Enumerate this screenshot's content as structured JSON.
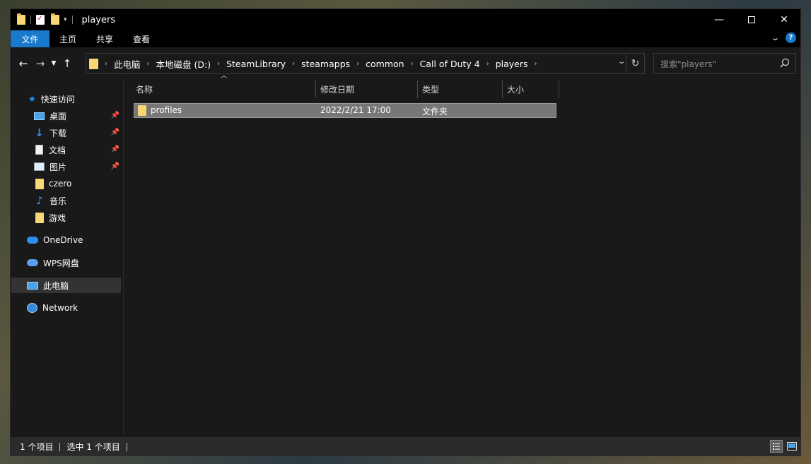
{
  "window": {
    "title": "players"
  },
  "ribbon": {
    "tabs": [
      "文件",
      "主页",
      "共享",
      "查看"
    ],
    "help_icon": "?"
  },
  "address": {
    "crumbs": [
      "此电脑",
      "本地磁盘 (D:)",
      "SteamLibrary",
      "steamapps",
      "common",
      "Call of Duty 4",
      "players"
    ],
    "search_placeholder": "搜索\"players\""
  },
  "nav": {
    "quick_access": "快速访问",
    "items": [
      {
        "label": "桌面",
        "icon": "desktop-icon",
        "pinned": true
      },
      {
        "label": "下载",
        "icon": "download-icon",
        "pinned": true
      },
      {
        "label": "文档",
        "icon": "documents-icon",
        "pinned": true
      },
      {
        "label": "图片",
        "icon": "pictures-icon",
        "pinned": true
      },
      {
        "label": "czero",
        "icon": "folder-icon",
        "pinned": false
      },
      {
        "label": "音乐",
        "icon": "music-icon",
        "pinned": false
      },
      {
        "label": "游戏",
        "icon": "folder-icon",
        "pinned": false
      }
    ],
    "onedrive": "OneDrive",
    "wps": "WPS网盘",
    "this_pc": "此电脑",
    "network": "Network"
  },
  "list": {
    "columns": [
      "名称",
      "修改日期",
      "类型",
      "大小"
    ],
    "rows": [
      {
        "name": "profiles",
        "date": "2022/2/21 17:00",
        "type": "文件夹",
        "size": ""
      }
    ]
  },
  "status": {
    "count": "1 个项目",
    "selected": "选中 1 个项目"
  },
  "colors": {
    "accent": "#1979ca",
    "folder": "#f8d775",
    "selection": "#777777"
  }
}
